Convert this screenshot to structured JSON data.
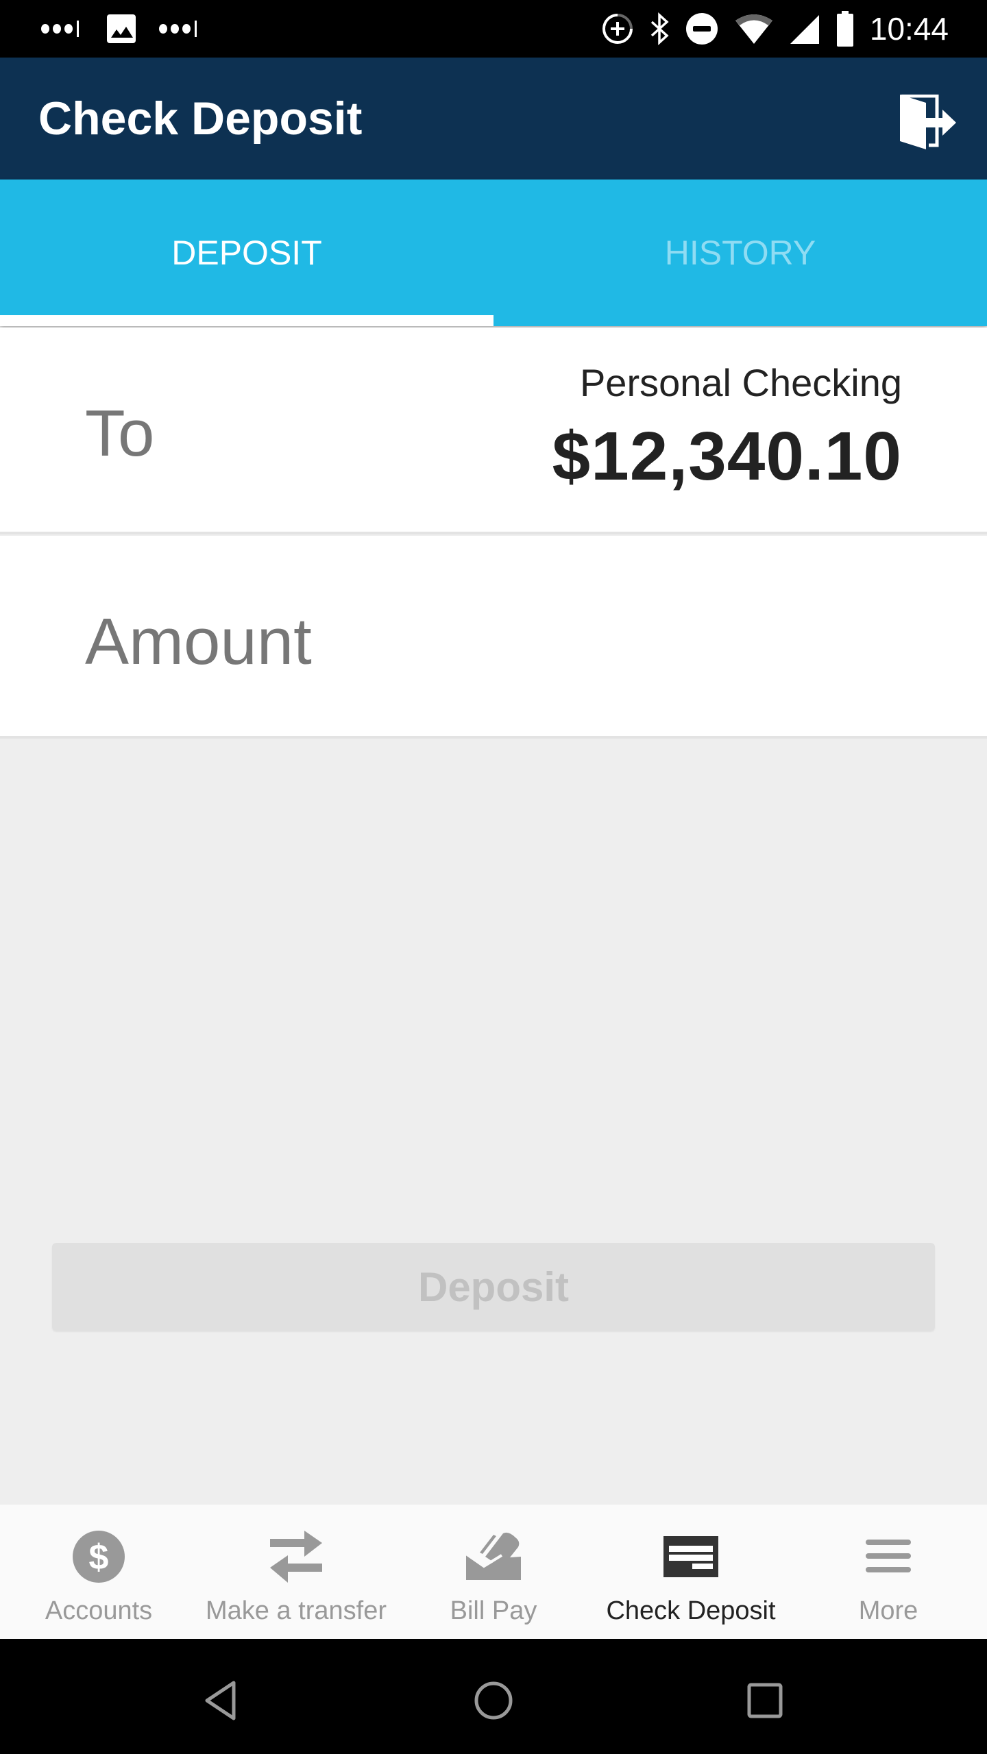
{
  "status_bar": {
    "time": "10:44",
    "icons_left": [
      "signal-dots-icon",
      "image-notification-icon",
      "signal-dots-icon"
    ],
    "icons_right": [
      "data-saver-icon",
      "bluetooth-icon",
      "do-not-disturb-icon",
      "wifi-icon",
      "cell-signal-icon",
      "battery-icon"
    ]
  },
  "app_bar": {
    "title": "Check Deposit",
    "logout_icon": "logout-door-icon"
  },
  "tabs": [
    {
      "label": "DEPOSIT",
      "active": true
    },
    {
      "label": "HISTORY",
      "active": false
    }
  ],
  "form": {
    "to_label": "To",
    "account_name": "Personal Checking",
    "account_balance": "$12,340.10",
    "amount_label": "Amount",
    "amount_value": ""
  },
  "deposit_button": {
    "label": "Deposit",
    "enabled": false
  },
  "bottom_nav": [
    {
      "label": "Accounts",
      "icon": "dollar-circle-icon",
      "active": false
    },
    {
      "label": "Make a transfer",
      "icon": "transfer-arrows-icon",
      "active": false
    },
    {
      "label": "Bill Pay",
      "icon": "bill-envelope-icon",
      "active": false
    },
    {
      "label": "Check Deposit",
      "icon": "check-icon",
      "active": true
    },
    {
      "label": "More",
      "icon": "menu-icon",
      "active": false
    }
  ],
  "colors": {
    "app_bar": "#0d3152",
    "tab_bar": "#20b9e5",
    "tab_inactive_text": "#8fdcf3",
    "nav_inactive": "#999999",
    "nav_active": "#222222"
  }
}
